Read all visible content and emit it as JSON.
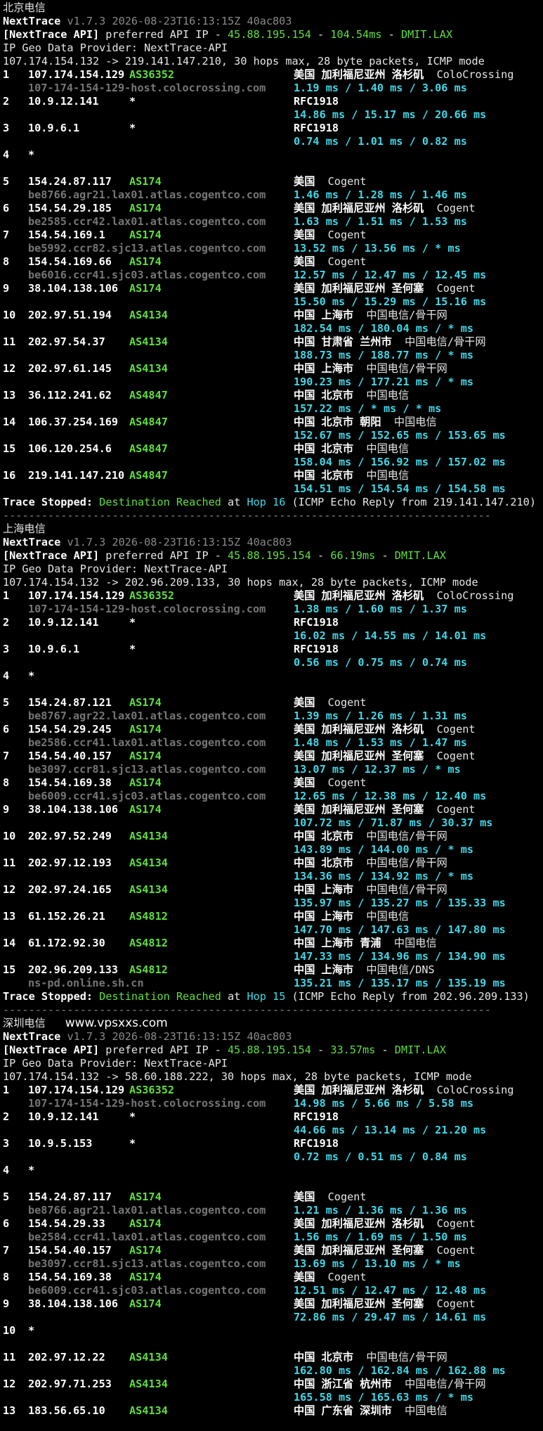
{
  "watermark": "www.vpsxxs.com",
  "sections": [
    {
      "title": "北京电信",
      "hops": [
        {
          "num": "1",
          "ip": "107.174.154.129",
          "asn": "AS36352",
          "geo": "美国 加利福尼亚州 洛杉矶",
          "isp": "ColoCrossing",
          "host": "107-174-154-129-host.colocrossing.com",
          "rtt": "1.19 ms / 1.40 ms / 3.06 ms"
        },
        {
          "num": "2",
          "ip": "10.9.12.141",
          "asn": "*",
          "geo": "RFC1918",
          "isp": "",
          "host": "",
          "rtt": "14.86 ms / 15.17 ms / 20.66 ms"
        },
        {
          "num": "3",
          "ip": "10.9.6.1",
          "asn": "*",
          "geo": "RFC1918",
          "isp": "",
          "host": "",
          "rtt": "0.74 ms / 1.01 ms / 0.82 ms"
        },
        {
          "num": "4",
          "ip": "*",
          "asn": "",
          "geo": "",
          "isp": "",
          "host": "",
          "rtt": ""
        },
        {
          "num": "5",
          "ip": "154.24.87.117",
          "asn": "AS174",
          "geo": "美国",
          "isp": "Cogent",
          "host": "be8766.agr21.lax01.atlas.cogentco.com",
          "rtt": "1.46 ms / 1.28 ms / 1.46 ms"
        },
        {
          "num": "6",
          "ip": "154.54.29.185",
          "asn": "AS174",
          "geo": "美国 加利福尼亚州 洛杉矶",
          "isp": "Cogent",
          "host": "be2585.ccr42.lax01.atlas.cogentco.com",
          "rtt": "1.63 ms / 1.51 ms / 1.53 ms"
        },
        {
          "num": "7",
          "ip": "154.54.169.1",
          "asn": "AS174",
          "geo": "美国",
          "isp": "Cogent",
          "host": "be5992.ccr82.sjc13.atlas.cogentco.com",
          "rtt": "13.52 ms / 13.56 ms / * ms"
        },
        {
          "num": "8",
          "ip": "154.54.169.66",
          "asn": "AS174",
          "geo": "美国",
          "isp": "Cogent",
          "host": "be6016.ccr41.sjc03.atlas.cogentco.com",
          "rtt": "12.57 ms / 12.47 ms / 12.45 ms"
        },
        {
          "num": "9",
          "ip": "38.104.138.106",
          "asn": "AS174",
          "geo": "美国 加利福尼亚州 圣何塞",
          "isp": "Cogent",
          "host": "",
          "rtt": "15.50 ms / 15.29 ms / 15.16 ms"
        },
        {
          "num": "10",
          "ip": "202.97.51.194",
          "asn": "AS4134",
          "geo": "中国 上海市",
          "isp": "中国电信/骨干网",
          "host": "",
          "rtt": "182.54 ms / 180.04 ms / * ms"
        },
        {
          "num": "11",
          "ip": "202.97.54.37",
          "asn": "AS4134",
          "geo": "中国 甘肃省 兰州市",
          "isp": "中国电信/骨干网",
          "host": "",
          "rtt": "188.73 ms / 188.77 ms / * ms"
        },
        {
          "num": "12",
          "ip": "202.97.61.145",
          "asn": "AS4134",
          "geo": "中国 上海市",
          "isp": "中国电信/骨干网",
          "host": "",
          "rtt": "190.23 ms / 177.21 ms / * ms"
        },
        {
          "num": "13",
          "ip": "36.112.241.62",
          "asn": "AS4847",
          "geo": "中国 北京市",
          "isp": "中国电信",
          "host": "",
          "rtt": "157.22 ms / * ms / * ms"
        },
        {
          "num": "14",
          "ip": "106.37.254.169",
          "asn": "AS4847",
          "geo": "中国 北京市 朝阳",
          "isp": "中国电信",
          "host": "",
          "rtt": "152.67 ms / 152.65 ms / 153.65 ms"
        },
        {
          "num": "15",
          "ip": "106.120.254.6",
          "asn": "AS4847",
          "geo": "中国 北京市",
          "isp": "中国电信",
          "host": "",
          "rtt": "158.04 ms / 156.92 ms / 157.02 ms"
        },
        {
          "num": "16",
          "ip": "219.141.147.210",
          "asn": "AS4847",
          "geo": "中国 北京市",
          "isp": "中国电信",
          "host": "",
          "rtt": "154.51 ms / 154.54 ms / 154.58 ms"
        }
      ],
      "header_api_latency": "104.54ms",
      "header_target": "107.174.154.132 -> 219.141.147.210, 30 hops max, 28 byte packets, ICMP mode",
      "stop_hop": "Hop 16",
      "stop_detail": "(ICMP Echo Reply from 219.141.147.210)"
    },
    {
      "title": "上海电信",
      "hops": [
        {
          "num": "1",
          "ip": "107.174.154.129",
          "asn": "AS36352",
          "geo": "美国 加利福尼亚州 洛杉矶",
          "isp": "ColoCrossing",
          "host": "107-174-154-129-host.colocrossing.com",
          "rtt": "1.38 ms / 1.60 ms / 1.37 ms"
        },
        {
          "num": "2",
          "ip": "10.9.12.141",
          "asn": "*",
          "geo": "RFC1918",
          "isp": "",
          "host": "",
          "rtt": "16.02 ms / 14.55 ms / 14.01 ms"
        },
        {
          "num": "3",
          "ip": "10.9.6.1",
          "asn": "*",
          "geo": "RFC1918",
          "isp": "",
          "host": "",
          "rtt": "0.56 ms / 0.75 ms / 0.74 ms"
        },
        {
          "num": "4",
          "ip": "*",
          "asn": "",
          "geo": "",
          "isp": "",
          "host": "",
          "rtt": ""
        },
        {
          "num": "5",
          "ip": "154.24.87.121",
          "asn": "AS174",
          "geo": "美国",
          "isp": "Cogent",
          "host": "be8767.agr22.lax01.atlas.cogentco.com",
          "rtt": "1.39 ms / 1.26 ms / 1.31 ms"
        },
        {
          "num": "6",
          "ip": "154.54.29.245",
          "asn": "AS174",
          "geo": "美国 加利福尼亚州 洛杉矶",
          "isp": "Cogent",
          "host": "be2586.ccr41.lax01.atlas.cogentco.com",
          "rtt": "1.48 ms / 1.53 ms / 1.47 ms"
        },
        {
          "num": "7",
          "ip": "154.54.40.157",
          "asn": "AS174",
          "geo": "美国 加利福尼亚州 圣何塞",
          "isp": "Cogent",
          "host": "be3097.ccr81.sjc13.atlas.cogentco.com",
          "rtt": "13.07 ms / 12.37 ms / * ms"
        },
        {
          "num": "8",
          "ip": "154.54.169.38",
          "asn": "AS174",
          "geo": "美国",
          "isp": "Cogent",
          "host": "be6009.ccr41.sjc03.atlas.cogentco.com",
          "rtt": "12.65 ms / 12.38 ms / 12.40 ms"
        },
        {
          "num": "9",
          "ip": "38.104.138.106",
          "asn": "AS174",
          "geo": "美国 加利福尼亚州 圣何塞",
          "isp": "Cogent",
          "host": "",
          "rtt": "107.72 ms / 71.87 ms / 30.37 ms"
        },
        {
          "num": "10",
          "ip": "202.97.52.249",
          "asn": "AS4134",
          "geo": "中国 北京市",
          "isp": "中国电信/骨干网",
          "host": "",
          "rtt": "143.89 ms / 144.00 ms / * ms"
        },
        {
          "num": "11",
          "ip": "202.97.12.193",
          "asn": "AS4134",
          "geo": "中国 北京市",
          "isp": "中国电信/骨干网",
          "host": "",
          "rtt": "134.36 ms / 134.92 ms / * ms"
        },
        {
          "num": "12",
          "ip": "202.97.24.165",
          "asn": "AS4134",
          "geo": "中国 上海市",
          "isp": "中国电信/骨干网",
          "host": "",
          "rtt": "135.97 ms / 135.27 ms / 135.33 ms"
        },
        {
          "num": "13",
          "ip": "61.152.26.21",
          "asn": "AS4812",
          "geo": "中国 上海市",
          "isp": "中国电信",
          "host": "",
          "rtt": "147.70 ms / 147.63 ms / 147.80 ms"
        },
        {
          "num": "14",
          "ip": "61.172.92.30",
          "asn": "AS4812",
          "geo": "中国 上海市 青浦",
          "isp": "中国电信",
          "host": "",
          "rtt": "147.33 ms / 134.96 ms / 134.90 ms"
        },
        {
          "num": "15",
          "ip": "202.96.209.133",
          "asn": "AS4812",
          "geo": "中国 上海市",
          "isp": "中国电信/DNS",
          "host": "ns-pd.online.sh.cn",
          "rtt": "135.21 ms / 135.17 ms / 135.19 ms"
        }
      ],
      "header_api_latency": "66.19ms",
      "header_target": "107.174.154.132 -> 202.96.209.133, 30 hops max, 28 byte packets, ICMP mode",
      "stop_hop": "Hop 15",
      "stop_detail": "(ICMP Echo Reply from 202.96.209.133)"
    },
    {
      "title": "深圳电信",
      "hops": [
        {
          "num": "1",
          "ip": "107.174.154.129",
          "asn": "AS36352",
          "geo": "美国 加利福尼亚州 洛杉矶",
          "isp": "ColoCrossing",
          "host": "107-174-154-129-host.colocrossing.com",
          "rtt": "14.98 ms / 5.66 ms / 5.58 ms"
        },
        {
          "num": "2",
          "ip": "10.9.12.141",
          "asn": "*",
          "geo": "RFC1918",
          "isp": "",
          "host": "",
          "rtt": "44.66 ms / 13.14 ms / 21.20 ms"
        },
        {
          "num": "3",
          "ip": "10.9.5.153",
          "asn": "*",
          "geo": "RFC1918",
          "isp": "",
          "host": "",
          "rtt": "0.72 ms / 0.51 ms / 0.84 ms"
        },
        {
          "num": "4",
          "ip": "*",
          "asn": "",
          "geo": "",
          "isp": "",
          "host": "",
          "rtt": ""
        },
        {
          "num": "5",
          "ip": "154.24.87.117",
          "asn": "AS174",
          "geo": "美国",
          "isp": "Cogent",
          "host": "be8766.agr21.lax01.atlas.cogentco.com",
          "rtt": "1.21 ms / 1.36 ms / 1.36 ms"
        },
        {
          "num": "6",
          "ip": "154.54.29.33",
          "asn": "AS174",
          "geo": "美国 加利福尼亚州 洛杉矶",
          "isp": "Cogent",
          "host": "be2584.ccr41.lax01.atlas.cogentco.com",
          "rtt": "1.56 ms / 1.69 ms / 1.50 ms"
        },
        {
          "num": "7",
          "ip": "154.54.40.157",
          "asn": "AS174",
          "geo": "美国 加利福尼亚州 圣何塞",
          "isp": "Cogent",
          "host": "be3097.ccr81.sjc13.atlas.cogentco.com",
          "rtt": "13.69 ms / 13.10 ms / * ms"
        },
        {
          "num": "8",
          "ip": "154.54.169.38",
          "asn": "AS174",
          "geo": "美国",
          "isp": "Cogent",
          "host": "be6009.ccr41.sjc03.atlas.cogentco.com",
          "rtt": "12.51 ms / 12.47 ms / 12.48 ms"
        },
        {
          "num": "9",
          "ip": "38.104.138.106",
          "asn": "AS174",
          "geo": "美国 加利福尼亚州 圣何塞",
          "isp": "Cogent",
          "host": "",
          "rtt": "72.86 ms / 29.47 ms / 14.61 ms"
        },
        {
          "num": "10",
          "ip": "*",
          "asn": "",
          "geo": "",
          "isp": "",
          "host": "",
          "rtt": ""
        },
        {
          "num": "11",
          "ip": "202.97.12.22",
          "asn": "AS4134",
          "geo": "中国 北京市",
          "isp": "中国电信/骨干网",
          "host": "",
          "rtt": "162.80 ms / 162.84 ms / 162.88 ms"
        },
        {
          "num": "12",
          "ip": "202.97.71.253",
          "asn": "AS4134",
          "geo": "中国 浙江省 杭州市",
          "isp": "中国电信/骨干网",
          "host": "",
          "rtt": "165.58 ms / 165.63 ms / * ms"
        },
        {
          "num": "13",
          "ip": "183.56.65.10",
          "asn": "AS4134",
          "geo": "中国 广东省 深圳市",
          "isp": "中国电信",
          "host": "",
          "rtt": ""
        }
      ],
      "header_api_latency": "33.57ms",
      "header_target": "107.174.154.132 -> 58.60.188.222, 30 hops max, 28 byte packets, ICMP mode",
      "stop_hop": "",
      "stop_detail": ""
    }
  ],
  "common": {
    "app_name": "NextTrace",
    "version_line": " v1.7.3 2026-08-23T16:13:15Z 40ac803",
    "api_label": "[NextTrace API]",
    "api_pref": " preferred API IP - ",
    "api_ip": "45.88.195.154",
    "api_dash": " - ",
    "api_dash2": " - ",
    "api_site": "DMIT.LAX",
    "geo_provider": "IP Geo Data Provider: NextTrace-API",
    "stop_label": "Trace Stopped:",
    "stop_reached": "Destination Reached",
    "stop_at": " at ",
    "divider": "----------------------------------------------------------------------------"
  }
}
